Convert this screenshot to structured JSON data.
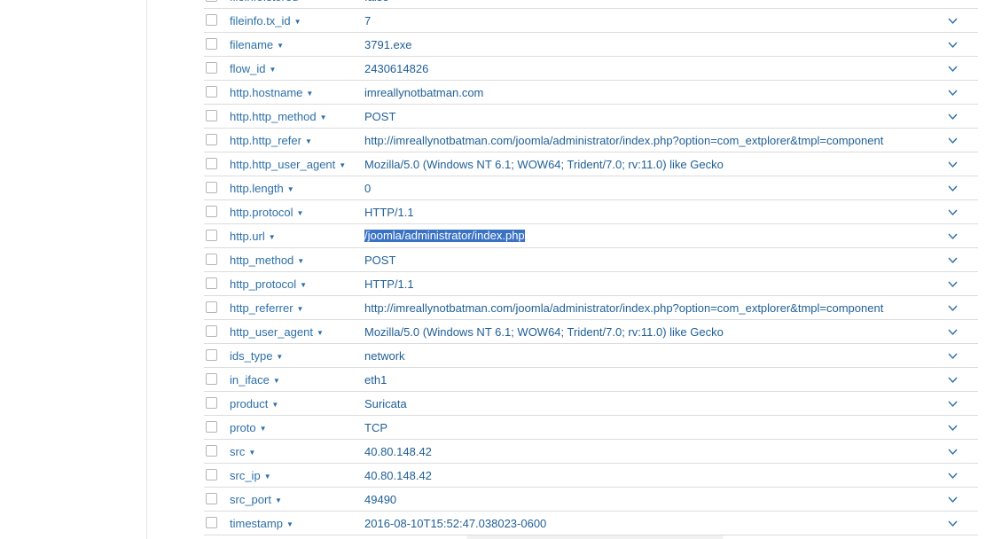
{
  "rows": [
    {
      "field": "fileinfo.stored",
      "value": "false"
    },
    {
      "field": "fileinfo.tx_id",
      "value": "7"
    },
    {
      "field": "filename",
      "value": "3791.exe"
    },
    {
      "field": "flow_id",
      "value": "2430614826"
    },
    {
      "field": "http.hostname",
      "value": "imreallynotbatman.com"
    },
    {
      "field": "http.http_method",
      "value": "POST"
    },
    {
      "field": "http.http_refer",
      "value": "http://imreallynotbatman.com/joomla/administrator/index.php?option=com_extplorer&tmpl=component"
    },
    {
      "field": "http.http_user_agent",
      "value": "Mozilla/5.0 (Windows NT 6.1; WOW64; Trident/7.0; rv:11.0) like Gecko"
    },
    {
      "field": "http.length",
      "value": "0"
    },
    {
      "field": "http.protocol",
      "value": "HTTP/1.1"
    },
    {
      "field": "http.url",
      "value": "/joomla/administrator/index.php",
      "selected": true
    },
    {
      "field": "http_method",
      "value": "POST"
    },
    {
      "field": "http_protocol",
      "value": "HTTP/1.1"
    },
    {
      "field": "http_referrer",
      "value": "http://imreallynotbatman.com/joomla/administrator/index.php?option=com_extplorer&tmpl=component"
    },
    {
      "field": "http_user_agent",
      "value": "Mozilla/5.0 (Windows NT 6.1; WOW64; Trident/7.0; rv:11.0) like Gecko"
    },
    {
      "field": "ids_type",
      "value": "network"
    },
    {
      "field": "in_iface",
      "value": "eth1"
    },
    {
      "field": "product",
      "value": "Suricata"
    },
    {
      "field": "proto",
      "value": "TCP"
    },
    {
      "field": "src",
      "value": "40.80.148.42"
    },
    {
      "field": "src_ip",
      "value": "40.80.148.42"
    },
    {
      "field": "src_port",
      "value": "49490"
    },
    {
      "field": "timestamp",
      "value": "2016-08-10T15:52:47.038023-0600"
    }
  ],
  "icons": {
    "field_menu": "caret-down-icon",
    "row_expand": "chevron-down-icon"
  },
  "colors": {
    "link": "#2d6fa8",
    "selection": "#3a72c4",
    "divider": "#dcdcdc"
  }
}
